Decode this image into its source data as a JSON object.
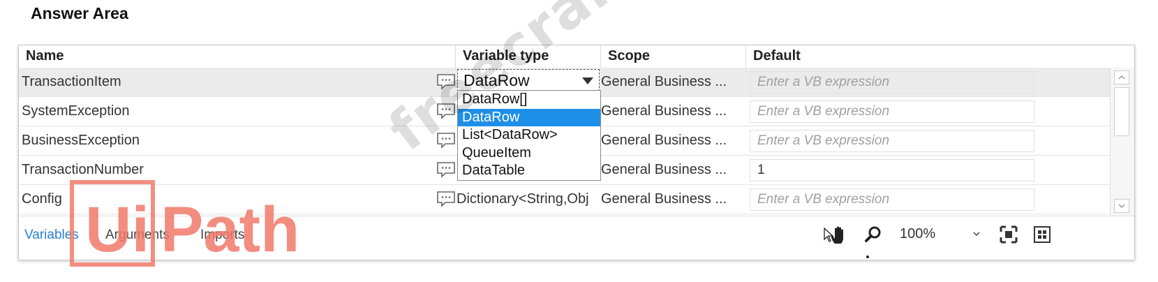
{
  "answer_title": "Answer Area",
  "headers": {
    "name": "Name",
    "variable_type": "Variable type",
    "scope": "Scope",
    "default": "Default"
  },
  "rows": [
    {
      "name": "TransactionItem",
      "type": "",
      "scope": "General Business ...",
      "default": "Enter a VB expression"
    },
    {
      "name": "SystemException",
      "type": "",
      "scope": "General Business ...",
      "default": "Enter a VB expression"
    },
    {
      "name": "BusinessException",
      "type": "",
      "scope": "General Business ...",
      "default": "Enter a VB expression"
    },
    {
      "name": "TransactionNumber",
      "type": "",
      "scope": "General Business ...",
      "default": "1"
    },
    {
      "name": "Config",
      "type": "Dictionary<String,Obj",
      "scope": "General Business ...",
      "default": "Enter a VB expression"
    }
  ],
  "type_select": {
    "value": "DataRow"
  },
  "dropdown_options": [
    "DataRow[]",
    "DataRow",
    "List<DataRow>",
    "QueueItem",
    "DataTable"
  ],
  "footer": {
    "tab_variables": "Variables",
    "tab_arguments": "Arguments",
    "tab_imports": "Imports",
    "zoom": "100%"
  },
  "logo_text": {
    "ui": "Ui",
    "path": "Path"
  },
  "watermark": "freecram.net",
  "colors": {
    "highlight": "#1e8fe8",
    "logo": "#f27a6a",
    "active_tab": "#2a7fcf"
  }
}
